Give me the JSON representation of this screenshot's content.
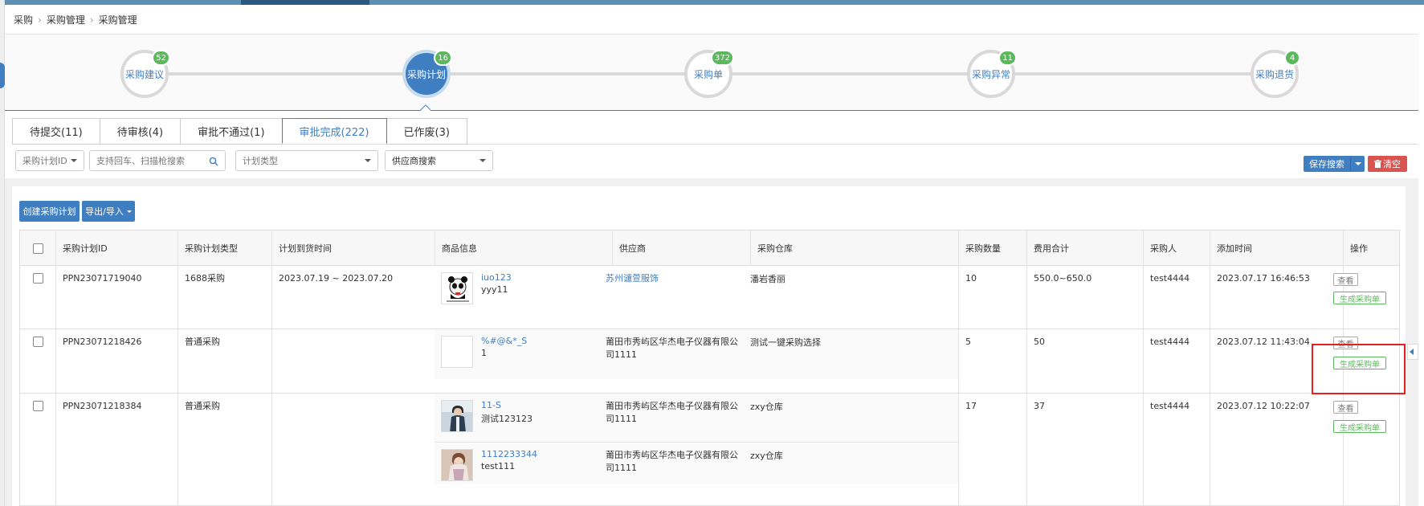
{
  "breadcrumb": [
    "采购",
    "采购管理",
    "采购管理"
  ],
  "steps": [
    {
      "label": "采购建议",
      "count": "52"
    },
    {
      "label": "采购计划",
      "count": "16"
    },
    {
      "label": "采购单",
      "count": "372"
    },
    {
      "label": "采购异常",
      "count": "11"
    },
    {
      "label": "采购退货",
      "count": "4"
    }
  ],
  "tabs": [
    "待提交(11)",
    "待审核(4)",
    "审批不通过(1)",
    "审批完成(222)",
    "已作废(3)"
  ],
  "filters": {
    "id_select": "采购计划ID",
    "search_placeholder": "支持回车、扫描枪搜索",
    "plan_type": "计划类型",
    "supplier": "供应商搜索"
  },
  "actions": {
    "save_search": "保存搜索",
    "clear": "清空",
    "create": "创建采购计划",
    "export": "导出/导入"
  },
  "columns": [
    "采购计划ID",
    "采购计划类型",
    "计划到货时间",
    "商品信息",
    "供应商",
    "采购仓库",
    "采购数量",
    "费用合计",
    "采购人",
    "添加时间",
    "操作"
  ],
  "rows": [
    {
      "id": "PPN23071719040",
      "type": "1688采购",
      "arrival": "2023.07.19 ~ 2023.07.20",
      "goods": [
        {
          "name": "iuo123",
          "sku": "yyy11",
          "supplier": "苏州谴萱服饰",
          "warehouse": "潘岩香丽",
          "thumb": "panda"
        }
      ],
      "qty": "10",
      "cost": "550.0~650.0",
      "buyer": "test4444",
      "added": "2023.07.17 16:46:53",
      "buttons": [
        "查看",
        "生成采购单"
      ]
    },
    {
      "id": "PPN23071218426",
      "type": "普通采购",
      "arrival": "",
      "goods": [
        {
          "name": "%#@&*_S",
          "sku": "1",
          "supplier": "莆田市秀屿区华杰电子仪器有限公司1111",
          "warehouse": "测试一键采购选择",
          "thumb": "blank"
        }
      ],
      "qty": "5",
      "cost": "50",
      "buyer": "test4444",
      "added": "2023.07.12 11:43:04",
      "buttons": [
        "查看",
        "生成采购单"
      ]
    },
    {
      "id": "PPN23071218384",
      "type": "普通采购",
      "arrival": "",
      "goods": [
        {
          "name": "11-S",
          "sku": "测试123123",
          "supplier": "莆田市秀屿区华杰电子仪器有限公司1111",
          "warehouse": "zxy仓库",
          "thumb": "person"
        },
        {
          "name": "1112233344",
          "sku": "test111",
          "supplier": "莆田市秀屿区华杰电子仪器有限公司1111",
          "warehouse": "zxy仓库",
          "thumb": "person2"
        }
      ],
      "qty": "17",
      "cost": "37",
      "buyer": "test4444",
      "added": "2023.07.12 10:22:07",
      "buttons": [
        "查看",
        "生成采购单"
      ]
    }
  ],
  "colors": {
    "primary": "#3f7ec1",
    "success": "#5cb85c",
    "danger": "#d9534f",
    "highlight": "#e52020"
  }
}
